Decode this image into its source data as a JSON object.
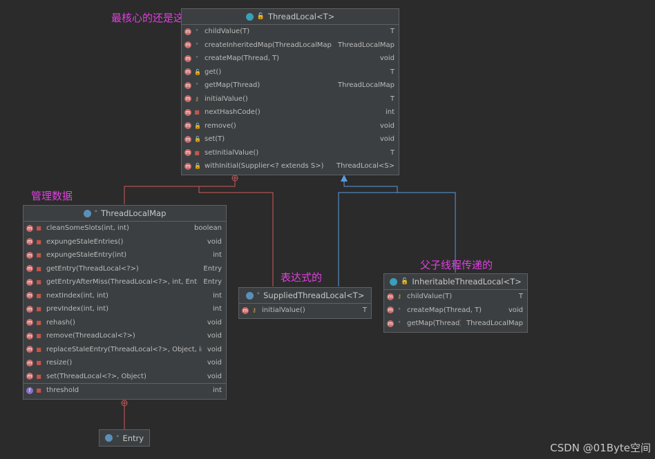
{
  "annotations": {
    "core": "最核心的还是这个",
    "manage": "管理数据",
    "expression": "表达式的",
    "inherit": "父子线程传递的"
  },
  "watermark": "CSDN @01Byte空间",
  "threadLocal": {
    "title": "ThreadLocal<T>",
    "members": [
      {
        "name": "childValue(T)",
        "type": "T"
      },
      {
        "name": "createInheritedMap(ThreadLocalMap)",
        "type": "ThreadLocalMap"
      },
      {
        "name": "createMap(Thread, T)",
        "type": "void"
      },
      {
        "name": "get()",
        "type": "T"
      },
      {
        "name": "getMap(Thread)",
        "type": "ThreadLocalMap"
      },
      {
        "name": "initialValue()",
        "type": "T"
      },
      {
        "name": "nextHashCode()",
        "type": "int"
      },
      {
        "name": "remove()",
        "type": "void"
      },
      {
        "name": "set(T)",
        "type": "void"
      },
      {
        "name": "setInitialValue()",
        "type": "T"
      },
      {
        "name": "withInitial(Supplier<? extends S>)",
        "type": "ThreadLocal<S>"
      }
    ]
  },
  "threadLocalMap": {
    "title": "ThreadLocalMap",
    "members": [
      {
        "name": "cleanSomeSlots(int, int)",
        "type": "boolean"
      },
      {
        "name": "expungeStaleEntries()",
        "type": "void"
      },
      {
        "name": "expungeStaleEntry(int)",
        "type": "int"
      },
      {
        "name": "getEntry(ThreadLocal<?>)",
        "type": "Entry"
      },
      {
        "name": "getEntryAfterMiss(ThreadLocal<?>, int, Entry)",
        "type": "Entry"
      },
      {
        "name": "nextIndex(int, int)",
        "type": "int"
      },
      {
        "name": "prevIndex(int, int)",
        "type": "int"
      },
      {
        "name": "rehash()",
        "type": "void"
      },
      {
        "name": "remove(ThreadLocal<?>)",
        "type": "void"
      },
      {
        "name": "replaceStaleEntry(ThreadLocal<?>, Object, int)",
        "type": "void"
      },
      {
        "name": "resize()",
        "type": "void"
      },
      {
        "name": "set(ThreadLocal<?>, Object)",
        "type": "void"
      }
    ],
    "field": {
      "name": "threshold",
      "type": "int"
    }
  },
  "supplied": {
    "title": "SuppliedThreadLocal<T>",
    "members": [
      {
        "name": "initialValue()",
        "type": "T"
      }
    ]
  },
  "inheritable": {
    "title": "InheritableThreadLocal<T>",
    "members": [
      {
        "name": "childValue(T)",
        "type": "T"
      },
      {
        "name": "createMap(Thread, T)",
        "type": "void"
      },
      {
        "name": "getMap(Thread)",
        "type": "ThreadLocalMap"
      }
    ]
  },
  "entry": {
    "title": "Entry"
  },
  "colors": {
    "inner": "#d05a5a",
    "extends": "#5a9be0",
    "annotation": "#e040e0"
  }
}
